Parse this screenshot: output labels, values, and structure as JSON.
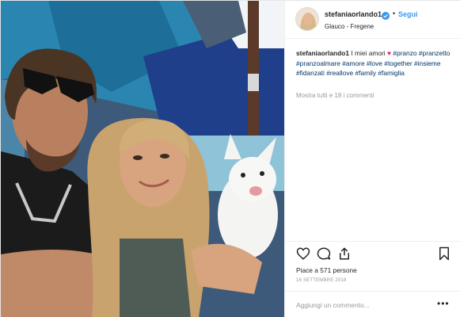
{
  "post": {
    "username": "stefaniaorlando1",
    "follow_label": "Segui",
    "separator": "•",
    "location": "Glauco - Fregene",
    "caption": {
      "username": "stefaniaorlando1",
      "text": "I miei amori",
      "heart": "♥",
      "hashtags": [
        "#pranzo",
        "#pranzetto",
        "#pranzoalmare",
        "#amore",
        "#love",
        "#together",
        "#insieme",
        "#fidanzati",
        "#reallove",
        "#family",
        "#famiglia"
      ]
    },
    "view_comments": "Mostra tutti e 18 i commenti",
    "likes_text": "Piace a 571 persone",
    "date": "16 SETTEMBRE 2018",
    "comment_placeholder": "Aggiungi un commento...",
    "more_label": "•••",
    "icons": {
      "like": "heart-outline-icon",
      "comment": "speech-bubble-icon",
      "share": "share-icon",
      "save": "bookmark-icon",
      "verified": "verified-badge-icon"
    },
    "colors": {
      "link": "#3897f0",
      "hashtag": "#003569",
      "muted": "#999999",
      "heart": "#e0245e",
      "verified": "#3897f0"
    }
  }
}
